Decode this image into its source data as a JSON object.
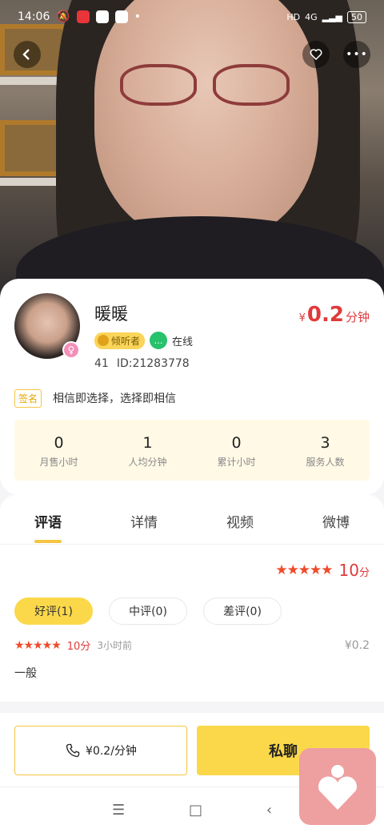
{
  "status_bar": {
    "time": "14:06",
    "network": "4G",
    "battery": "50"
  },
  "hero": {
    "back_icon": "back-arrow-icon",
    "favorite_icon": "heart-icon",
    "more_icon": "more-icon"
  },
  "profile": {
    "name": "暖暖",
    "price_symbol": "¥",
    "price_value": "0.2",
    "price_unit": "分钟",
    "badge_listener": "倾听者",
    "online_label": "在线",
    "level": "41",
    "user_id": "ID:21283778",
    "sign_tag": "签名",
    "signature": "相信即选择，选择即相信"
  },
  "stats": [
    {
      "value": "0",
      "label": "月售小时"
    },
    {
      "value": "1",
      "label": "人均分钟"
    },
    {
      "value": "0",
      "label": "累计小时"
    },
    {
      "value": "3",
      "label": "服务人数"
    }
  ],
  "tabs": [
    "评语",
    "详情",
    "视频",
    "微博"
  ],
  "reviews": {
    "overall_stars": "★★★★★",
    "overall_score": "10",
    "overall_unit": "分",
    "filters": [
      "好评(1)",
      "中评(0)",
      "差评(0)"
    ],
    "item": {
      "stars": "★★★★★",
      "score": "10分",
      "time": "3小时前",
      "fee": "¥0.2",
      "text": "一般"
    }
  },
  "actions": {
    "call_label": "¥0.2/分钟",
    "chat_label": "私聊"
  },
  "nav": {
    "menu": "☰",
    "home": "□",
    "back": "‹"
  },
  "colors": {
    "accent": "#fbd84a",
    "price": "#e03a3a",
    "stars": "#f04a2a"
  }
}
